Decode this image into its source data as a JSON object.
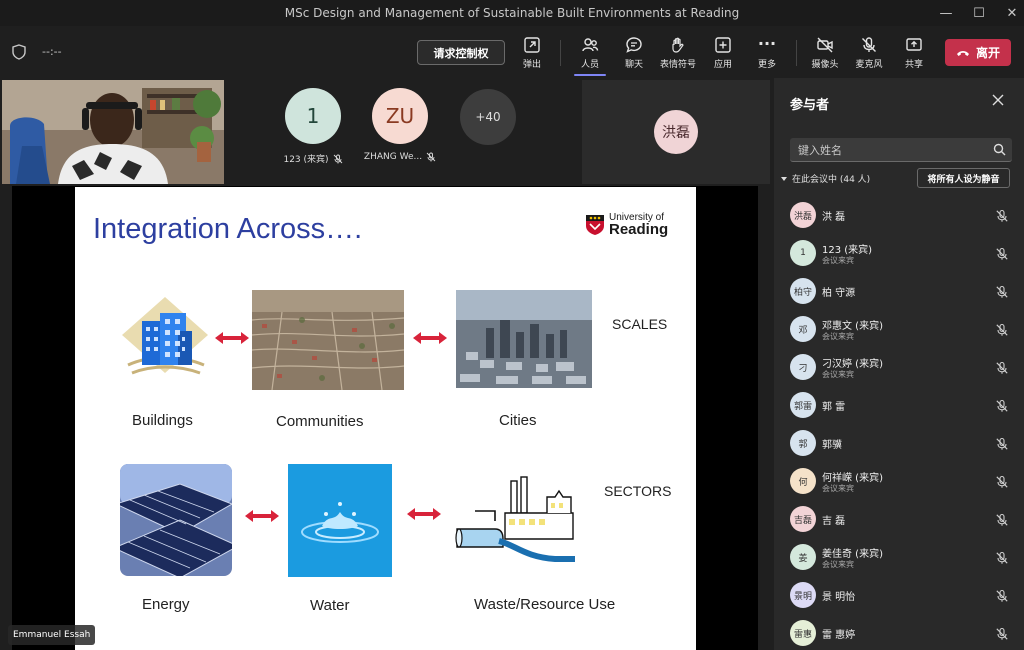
{
  "window": {
    "title": "MSc Design and Management of Sustainable Built Environments at Reading",
    "minimize": "—",
    "maximize": "☐",
    "close": "✕"
  },
  "toolbar": {
    "timer": "--:--",
    "request_control": "请求控制权",
    "items": {
      "popout": "弹出",
      "people": "人员",
      "chat": "聊天",
      "reactions": "表情符号",
      "apps": "应用",
      "more": "更多",
      "camera": "摄像头",
      "mic": "麦克风",
      "share": "共享"
    },
    "leave": "离开",
    "more_dots": "···"
  },
  "stage": {
    "avatars": [
      {
        "initials": "1",
        "name": "123 (来宾)",
        "bg": "#cfe4dc",
        "fg": "#23463a"
      },
      {
        "initials": "ZU",
        "name": "ZHANG We...",
        "bg": "#f7dad2",
        "fg": "#8a3a22"
      }
    ],
    "more_count": "+40",
    "speaker_initials": "洪磊",
    "presenter_name": "Emmanuel Essah"
  },
  "slide": {
    "title": "Integration Across….",
    "logo_line1": "University of",
    "logo_line2": "Reading",
    "scales": "SCALES",
    "sectors": "SECTORS",
    "labels": {
      "buildings": "Buildings",
      "communities": "Communities",
      "cities": "Cities",
      "energy": "Energy",
      "water": "Water",
      "waste": "Waste/Resource Use"
    }
  },
  "panel": {
    "title": "参与者",
    "search_placeholder": "键入姓名",
    "meeting_header": "在此会议中 (44 人)",
    "mute_all": "将所有人设为静音",
    "participants": [
      {
        "initials": "洪磊",
        "name": "洪 磊",
        "sub": "",
        "bg": "#f2d3d6"
      },
      {
        "initials": "1",
        "name": "123 (来宾)",
        "sub": "会议来宾",
        "bg": "#d4e8dc"
      },
      {
        "initials": "柏守",
        "name": "柏 守源",
        "sub": "",
        "bg": "#d7e3ee"
      },
      {
        "initials": "邓",
        "name": "邓惠文 (来宾)",
        "sub": "会议来宾",
        "bg": "#d7e3ee"
      },
      {
        "initials": "刁",
        "name": "刁汉婷 (来宾)",
        "sub": "会议来宾",
        "bg": "#d7e3ee"
      },
      {
        "initials": "郭雷",
        "name": "郭 雷",
        "sub": "",
        "bg": "#d7e3ee"
      },
      {
        "initials": "郭",
        "name": "郭骥",
        "sub": "",
        "bg": "#d7e3ee"
      },
      {
        "initials": "何",
        "name": "何祥嵘 (来宾)",
        "sub": "会议来宾",
        "bg": "#f5e2c9"
      },
      {
        "initials": "吉磊",
        "name": "吉 磊",
        "sub": "",
        "bg": "#f2d3d6"
      },
      {
        "initials": "姜",
        "name": "姜佳奇 (来宾)",
        "sub": "会议来宾",
        "bg": "#d4e8dc"
      },
      {
        "initials": "景明",
        "name": "景 明怡",
        "sub": "",
        "bg": "#dcdaf5"
      },
      {
        "initials": "雷惠",
        "name": "雷 惠婷",
        "sub": "",
        "bg": "#e5efd7"
      }
    ]
  },
  "colors": {
    "accent": "#7f85f5",
    "leave": "#c4314b",
    "slide_title": "#2d3fa0",
    "arrow": "#d8233a"
  }
}
